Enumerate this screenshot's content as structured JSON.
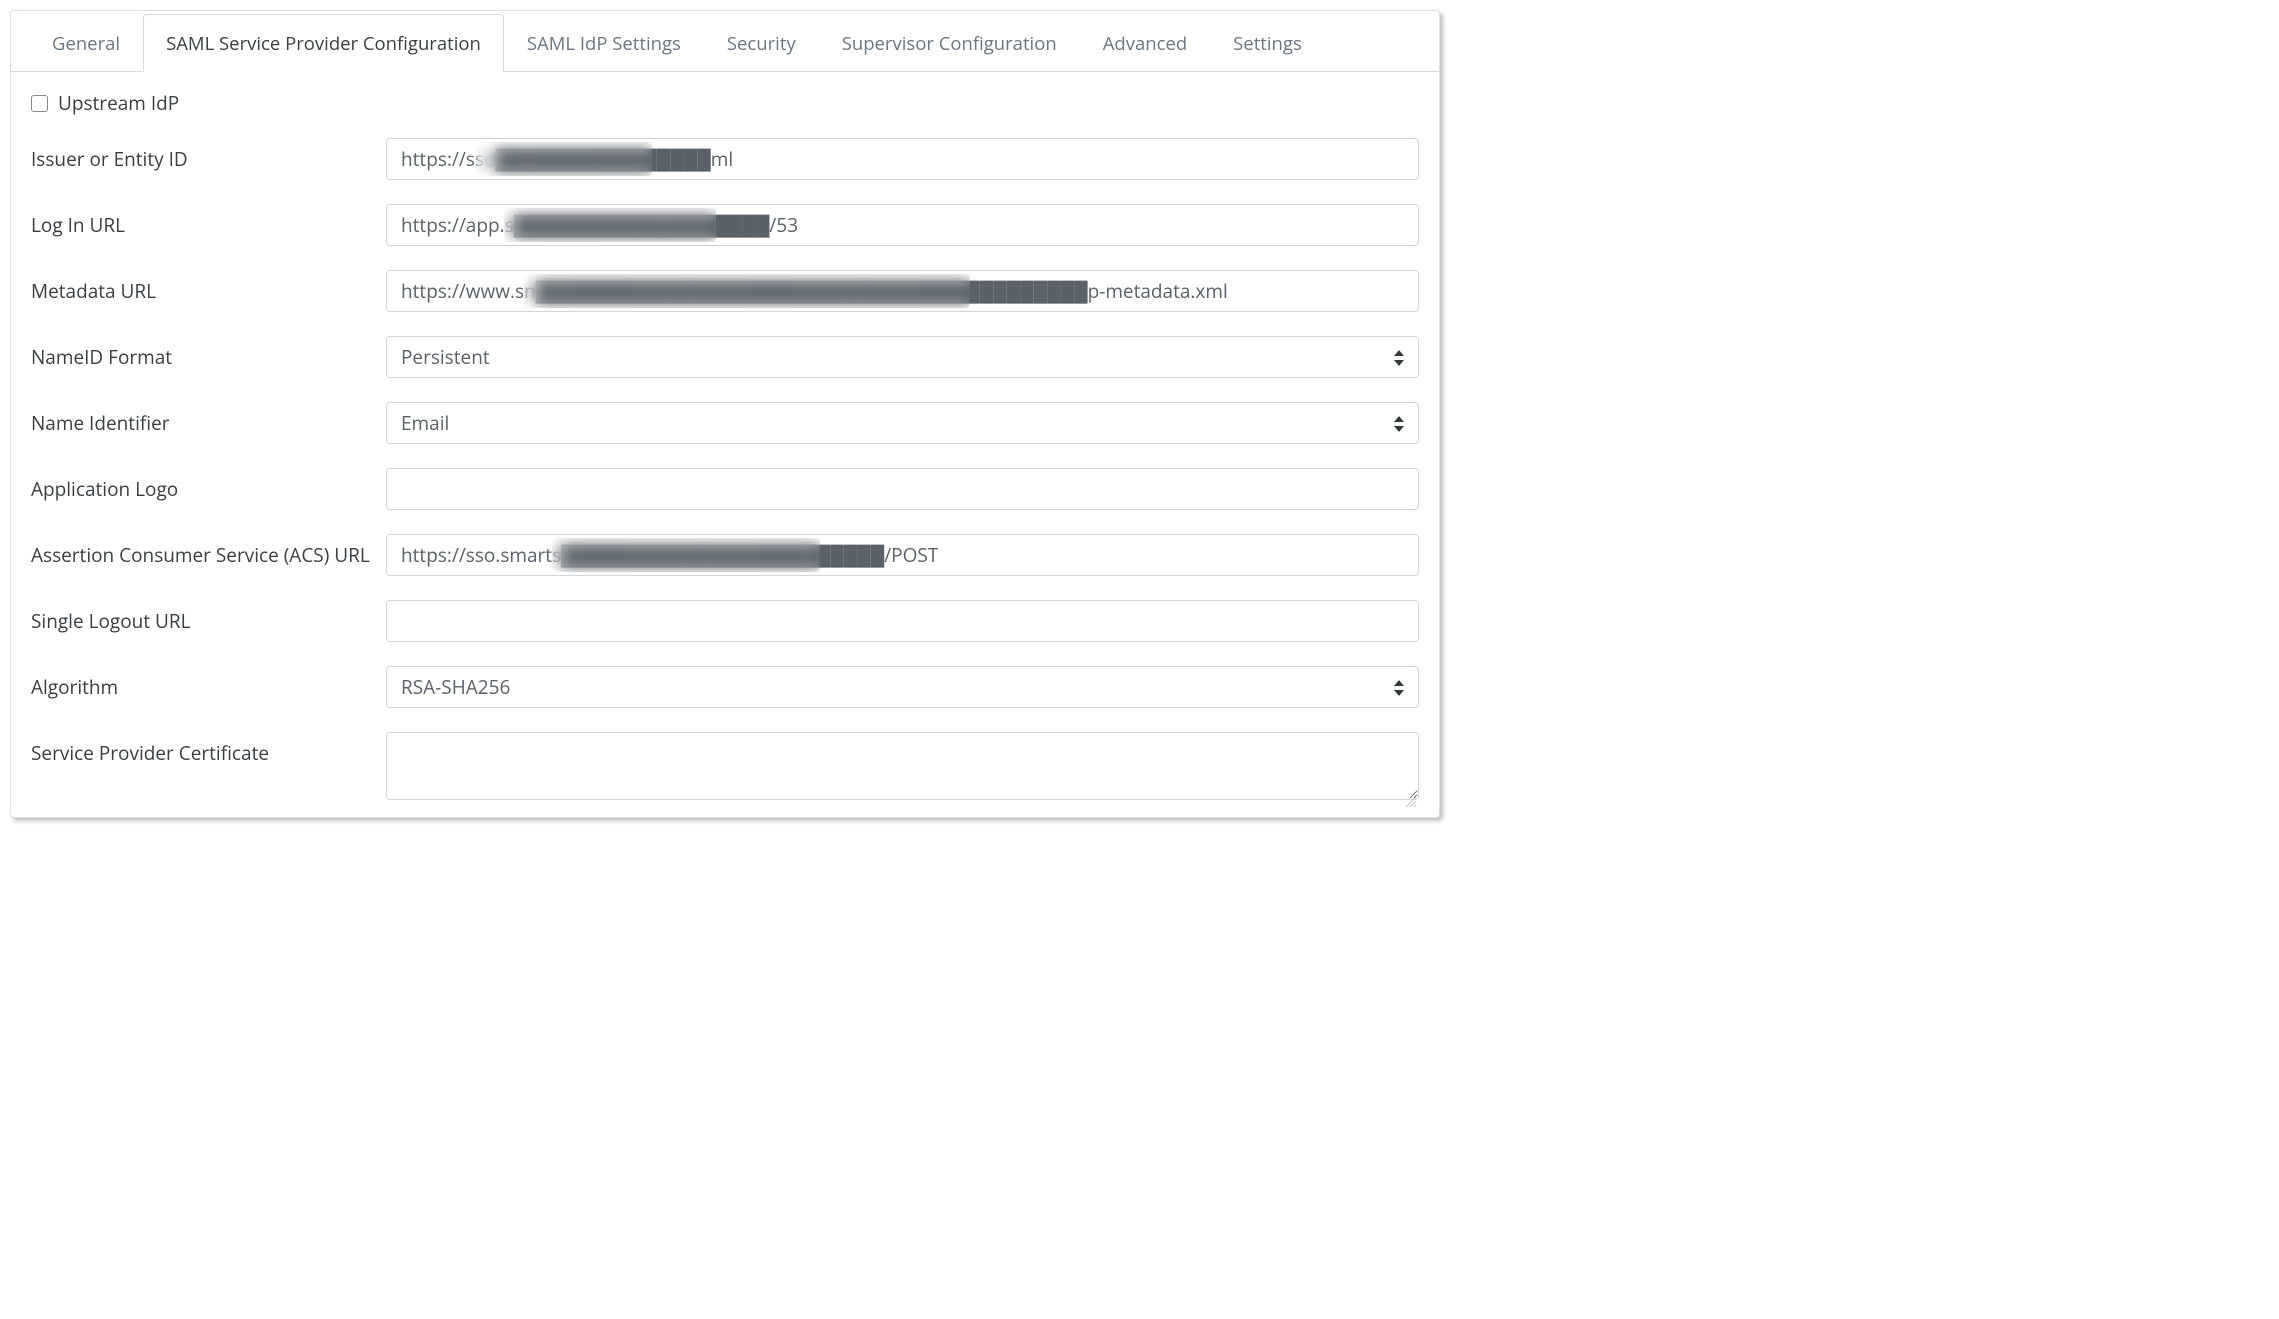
{
  "tabs": [
    {
      "label": "General"
    },
    {
      "label": "SAML Service Provider Configuration"
    },
    {
      "label": "SAML IdP Settings"
    },
    {
      "label": "Security"
    },
    {
      "label": "Supervisor Configuration"
    },
    {
      "label": "Advanced"
    },
    {
      "label": "Settings"
    }
  ],
  "active_tab_index": 1,
  "checkbox": {
    "upstream_idp_label": "Upstream IdP",
    "upstream_idp_checked": false
  },
  "fields": {
    "issuer": {
      "label": "Issuer or Entity ID",
      "value": "https://sso████████████████ml"
    },
    "login_url": {
      "label": "Log In URL",
      "value": "https://app.s███████████████████/53"
    },
    "metadata_url": {
      "label": "Metadata URL",
      "value": "https://www.sn█████████████████████████████████████████p-metadata.xml"
    },
    "nameid_format": {
      "label": "NameID Format",
      "value": "Persistent"
    },
    "name_identifier": {
      "label": "Name Identifier",
      "value": "Email"
    },
    "application_logo": {
      "label": "Application Logo",
      "value": ""
    },
    "acs_url": {
      "label": "Assertion Consumer Service (ACS) URL",
      "value": "https://sso.smarts████████████████████████/POST"
    },
    "slo_url": {
      "label": "Single Logout URL",
      "value": ""
    },
    "algorithm": {
      "label": "Algorithm",
      "value": "RSA-SHA256"
    },
    "sp_cert": {
      "label": "Service Provider Certificate",
      "value": ""
    }
  }
}
